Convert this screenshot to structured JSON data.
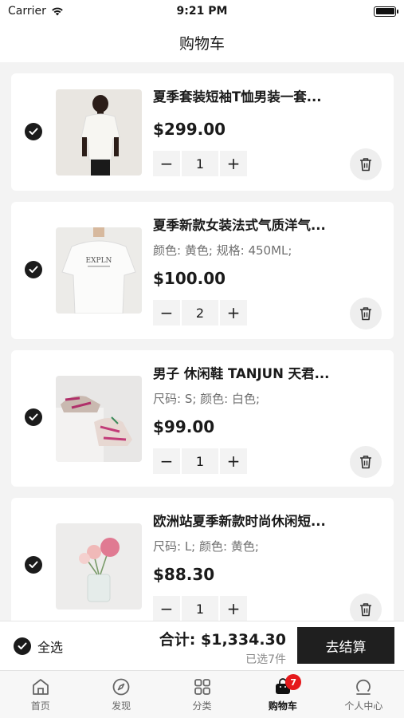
{
  "status_bar": {
    "carrier": "Carrier",
    "time": "9:21 PM"
  },
  "nav": {
    "title": "购物车"
  },
  "cart": {
    "items": [
      {
        "title": "夏季套装短袖T恤男装一套...",
        "spec": "",
        "price": "$299.00",
        "quantity": "1",
        "checked": true
      },
      {
        "title": "夏季新款女装法式气质洋气...",
        "spec": "颜色: 黄色; 规格: 450ML;",
        "price": "$100.00",
        "quantity": "2",
        "checked": true
      },
      {
        "title": "男子 休闲鞋 TANJUN 天君...",
        "spec": "尺码: S; 颜色: 白色;",
        "price": "$99.00",
        "quantity": "1",
        "checked": true
      },
      {
        "title": "欧洲站夏季新款时尚休闲短...",
        "spec": "尺码: L; 颜色: 黄色;",
        "price": "$88.30",
        "quantity": "1",
        "checked": true
      }
    ]
  },
  "stepper": {
    "minus": "−",
    "plus": "+"
  },
  "checkout": {
    "select_all_label": "全选",
    "total_label": "合计: $1,334.30",
    "selected_count": "已选7件",
    "button_label": "去结算"
  },
  "tabs": [
    {
      "label": "首页",
      "icon": "home-icon"
    },
    {
      "label": "发现",
      "icon": "compass-icon"
    },
    {
      "label": "分类",
      "icon": "grid-icon"
    },
    {
      "label": "购物车",
      "icon": "bag-icon",
      "badge": "7",
      "active": true
    },
    {
      "label": "个人中心",
      "icon": "profile-icon"
    }
  ],
  "colors": {
    "accent": "#1f1f1f",
    "badge": "#e5191c",
    "background": "#f3f3f3"
  }
}
